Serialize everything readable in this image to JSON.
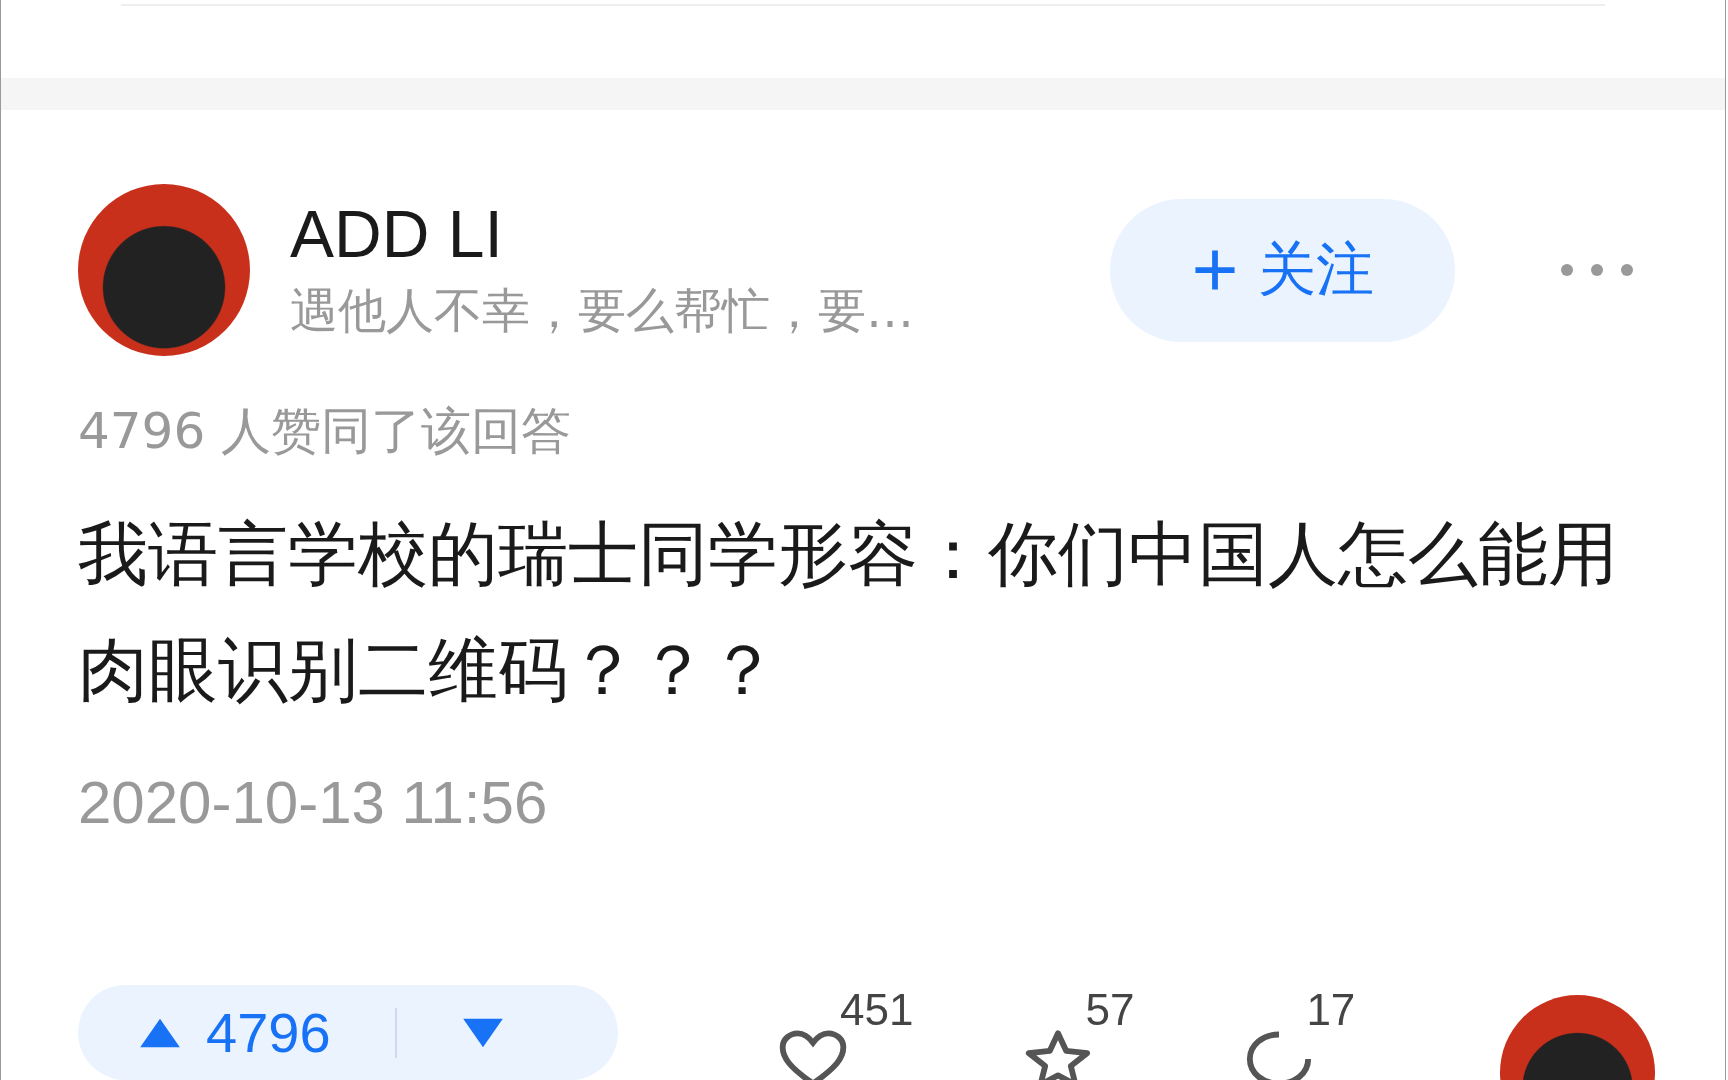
{
  "author": {
    "name": "ADD LI",
    "bio": "遇他人不幸，要么帮忙，要…"
  },
  "follow_button": {
    "label": "关注"
  },
  "agree_summary": "4796 人赞同了该回答",
  "content": "我语言学校的瑞士同学形容：你们中国人怎么能用肉眼识别二维码？？？",
  "date": "2020-10-13 11:56",
  "vote": {
    "count": "4796"
  },
  "actions": [
    {
      "kind": "heart",
      "count": "451"
    },
    {
      "kind": "star",
      "count": "57"
    },
    {
      "kind": "comment",
      "count": "17"
    }
  ]
}
